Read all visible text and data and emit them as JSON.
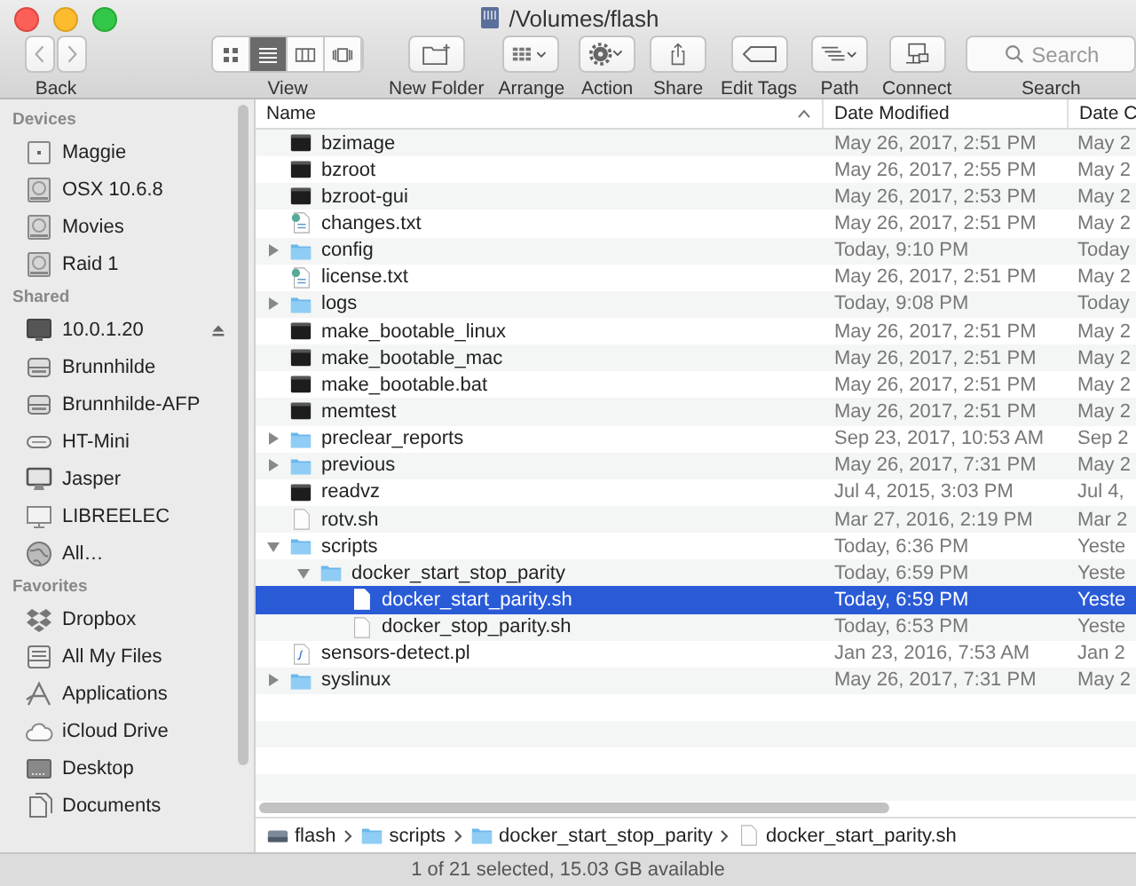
{
  "window": {
    "title": "/Volumes/flash"
  },
  "toolbar": {
    "nav_label": "Back",
    "view": {
      "label": "View",
      "modes": [
        {
          "kind": "icons",
          "selected": false
        },
        {
          "kind": "list",
          "selected": true
        },
        {
          "kind": "columns",
          "selected": false
        },
        {
          "kind": "cover",
          "selected": false
        }
      ]
    },
    "buttons": [
      {
        "kind": "new-folder",
        "label": "New Folder"
      },
      {
        "kind": "arrange",
        "label": "Arrange"
      },
      {
        "kind": "action",
        "label": "Action"
      },
      {
        "kind": "share",
        "label": "Share"
      },
      {
        "kind": "tags",
        "label": "Edit Tags"
      },
      {
        "kind": "path",
        "label": "Path"
      },
      {
        "kind": "connect",
        "label": "Connect"
      }
    ],
    "search": {
      "placeholder": "Search",
      "label": "Search"
    }
  },
  "sidebar": {
    "sections": [
      {
        "title": "Devices",
        "items": [
          {
            "label": "Maggie",
            "kind": "disk"
          },
          {
            "label": "OSX 10.6.8",
            "kind": "drive"
          },
          {
            "label": "Movies",
            "kind": "drive"
          },
          {
            "label": "Raid 1",
            "kind": "drive"
          }
        ]
      },
      {
        "title": "Shared",
        "items": [
          {
            "label": "10.0.1.20",
            "kind": "monitor",
            "ejectable": true
          },
          {
            "label": "Brunnhilde",
            "kind": "server",
            "ejectable": false
          },
          {
            "label": "Brunnhilde-AFP",
            "kind": "server",
            "ejectable": false
          },
          {
            "label": "HT-Mini",
            "kind": "mini",
            "ejectable": false
          },
          {
            "label": "Jasper",
            "kind": "imac",
            "ejectable": false
          },
          {
            "label": "LIBREELEC",
            "kind": "display",
            "ejectable": false
          },
          {
            "label": "All…",
            "kind": "globe",
            "ejectable": false
          }
        ]
      },
      {
        "title": "Favorites",
        "items": [
          {
            "label": "Dropbox",
            "kind": "dropbox"
          },
          {
            "label": "All My Files",
            "kind": "tray"
          },
          {
            "label": "Applications",
            "kind": "apps"
          },
          {
            "label": "iCloud Drive",
            "kind": "cloud"
          },
          {
            "label": "Desktop",
            "kind": "desktop"
          },
          {
            "label": "Documents",
            "kind": "documents"
          }
        ]
      }
    ]
  },
  "table": {
    "columns": [
      "Name",
      "Date Modified",
      "Date C"
    ],
    "files": [
      {
        "name": "bzimage",
        "kind": "exec",
        "modified": "May 26, 2017, 2:51 PM",
        "column_3": "May 2",
        "selected": false
      },
      {
        "name": "bzroot",
        "kind": "exec",
        "modified": "May 26, 2017, 2:55 PM",
        "column_3": "May 2",
        "selected": false
      },
      {
        "name": "bzroot-gui",
        "kind": "exec",
        "modified": "May 26, 2017, 2:53 PM",
        "column_3": "May 2",
        "selected": false
      },
      {
        "name": "changes.txt",
        "kind": "text",
        "modified": "May 26, 2017, 2:51 PM",
        "column_3": "May 2",
        "selected": false
      },
      {
        "name": "config",
        "kind": "folder",
        "expanded": false,
        "modified": "Today, 9:10 PM",
        "column_3": "Today",
        "selected": false
      },
      {
        "name": "license.txt",
        "kind": "text",
        "modified": "May 26, 2017, 2:51 PM",
        "column_3": "May 2",
        "selected": false
      },
      {
        "name": "logs",
        "kind": "folder",
        "expanded": false,
        "modified": "Today, 9:08 PM",
        "column_3": "Today",
        "selected": false
      },
      {
        "name": "make_bootable_linux",
        "kind": "exec",
        "modified": "May 26, 2017, 2:51 PM",
        "column_3": "May 2",
        "selected": false
      },
      {
        "name": "make_bootable_mac",
        "kind": "exec",
        "modified": "May 26, 2017, 2:51 PM",
        "column_3": "May 2",
        "selected": false
      },
      {
        "name": "make_bootable.bat",
        "kind": "exec",
        "modified": "May 26, 2017, 2:51 PM",
        "column_3": "May 2",
        "selected": false
      },
      {
        "name": "memtest",
        "kind": "exec",
        "modified": "May 26, 2017, 2:51 PM",
        "column_3": "May 2",
        "selected": false
      },
      {
        "name": "preclear_reports",
        "kind": "folder",
        "expanded": false,
        "modified": "Sep 23, 2017, 10:53 AM",
        "column_3": "Sep 2",
        "selected": false
      },
      {
        "name": "previous",
        "kind": "folder",
        "expanded": false,
        "modified": "May 26, 2017, 7:31 PM",
        "column_3": "May 2",
        "selected": false
      },
      {
        "name": "readvz",
        "kind": "exec",
        "modified": "Jul 4, 2015, 3:03 PM",
        "column_3": "Jul 4,",
        "selected": false
      },
      {
        "name": "rotv.sh",
        "kind": "doc",
        "modified": "Mar 27, 2016, 2:19 PM",
        "column_3": "Mar 2",
        "selected": false
      },
      {
        "name": "scripts",
        "kind": "folder",
        "expanded": true,
        "modified": "Today, 6:36 PM",
        "column_3": "Yeste",
        "selected": false,
        "children": [
          {
            "name": "docker_start_stop_parity",
            "kind": "folder",
            "expanded": true,
            "modified": "Today, 6:59 PM",
            "column_3": "Yeste",
            "selected": false,
            "children": [
              {
                "name": "docker_start_parity.sh",
                "kind": "doc",
                "modified": "Today, 6:59 PM",
                "column_3": "Yeste",
                "selected": true
              },
              {
                "name": "docker_stop_parity.sh",
                "kind": "doc",
                "modified": "Today, 6:53 PM",
                "column_3": "Yeste",
                "selected": false
              }
            ]
          }
        ]
      },
      {
        "name": "sensors-detect.pl",
        "kind": "script",
        "modified": "Jan 23, 2016, 7:53 AM",
        "column_3": "Jan 2",
        "selected": false
      },
      {
        "name": "syslinux",
        "kind": "folder",
        "expanded": false,
        "modified": "May 26, 2017, 7:31 PM",
        "column_3": "May 2",
        "selected": false
      }
    ]
  },
  "path_bar": [
    {
      "label": "flash",
      "kind": "drive"
    },
    {
      "label": "scripts",
      "kind": "folder"
    },
    {
      "label": "docker_start_stop_parity",
      "kind": "folder"
    },
    {
      "label": "docker_start_parity.sh",
      "kind": "doc"
    }
  ],
  "status_bar": "1 of 21 selected, 15.03 GB available"
}
